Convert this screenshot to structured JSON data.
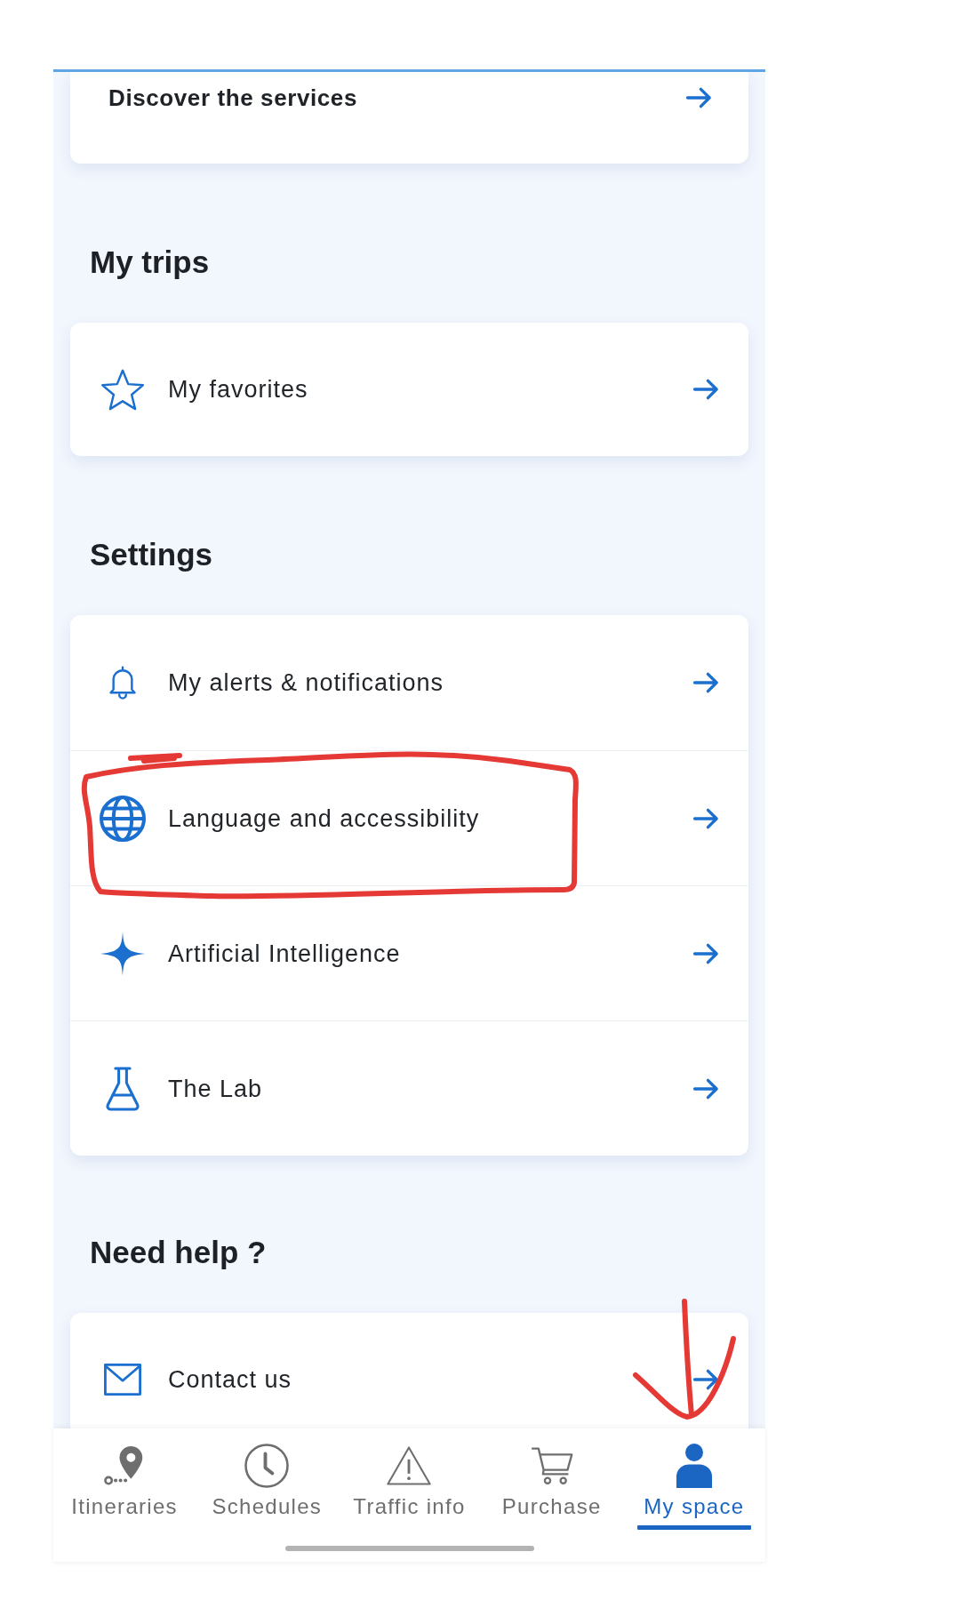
{
  "top_card": {
    "label": "Discover the services"
  },
  "sections": [
    {
      "title": "My trips",
      "items": [
        {
          "label": "My favorites",
          "circled": false
        }
      ]
    },
    {
      "title": "Settings",
      "items": [
        {
          "label": "My alerts & notifications",
          "circled": false
        },
        {
          "label": "Language and accessibility",
          "circled": true
        },
        {
          "label": "Artificial Intelligence",
          "circled": false
        },
        {
          "label": "The Lab",
          "circled": false
        }
      ]
    },
    {
      "title": "Need help ?",
      "items": [
        {
          "label": "Contact us",
          "circled": false
        }
      ]
    }
  ],
  "bottom_nav": [
    {
      "label": "Itineraries",
      "selected": false,
      "arrow_pointer": false
    },
    {
      "label": "Schedules",
      "selected": false,
      "arrow_pointer": false
    },
    {
      "label": "Traffic info",
      "selected": false,
      "arrow_pointer": false
    },
    {
      "label": "Purchase",
      "selected": false,
      "arrow_pointer": false
    },
    {
      "label": "My space",
      "selected": true,
      "arrow_pointer": true
    }
  ]
}
